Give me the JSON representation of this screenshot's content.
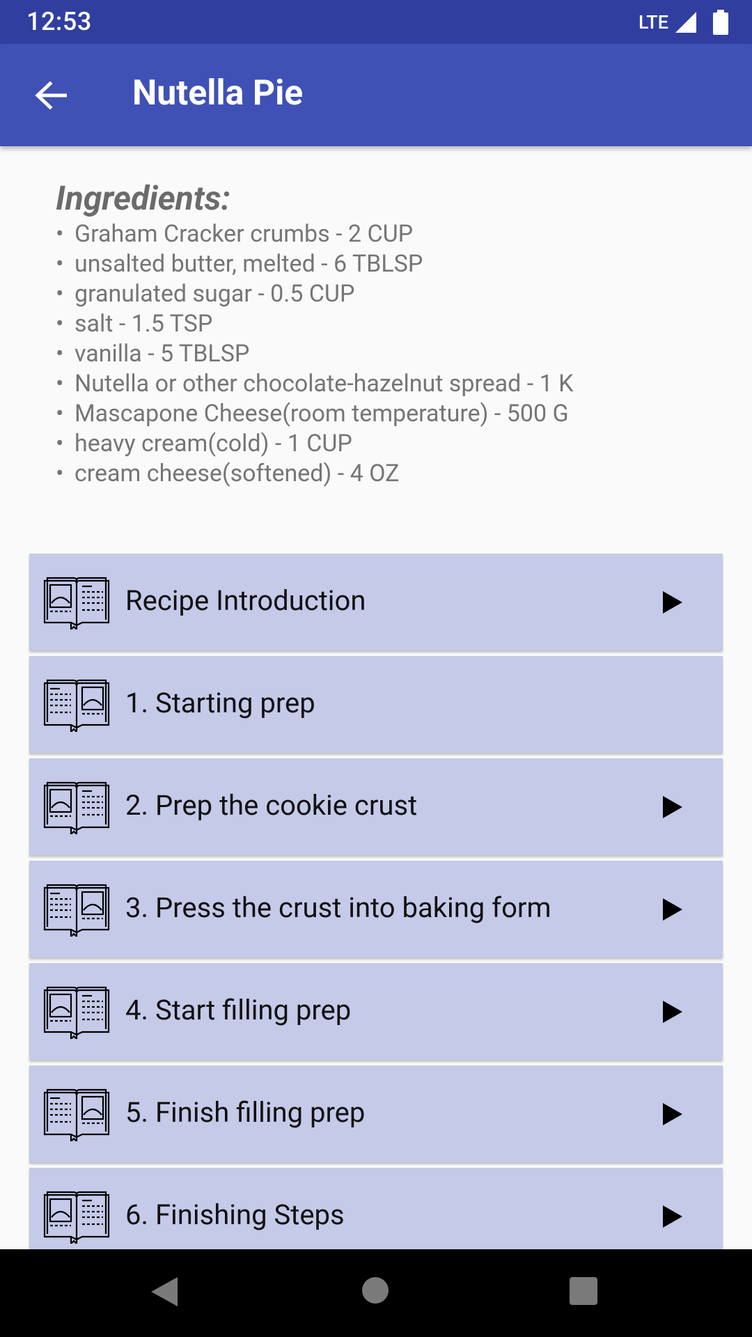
{
  "status": {
    "time": "12:53",
    "network": "LTE"
  },
  "app_bar": {
    "title": "Nutella Pie"
  },
  "ingredients": {
    "title": "Ingredients:",
    "bullet": "•",
    "items": [
      "Graham Cracker crumbs - 2 CUP",
      "unsalted butter, melted - 6 TBLSP",
      "granulated sugar - 0.5 CUP",
      "salt - 1.5 TSP",
      "vanilla - 5 TBLSP",
      "Nutella or other chocolate-hazelnut spread - 1 K",
      "Mascapone Cheese(room temperature) - 500 G",
      "heavy cream(cold) - 1 CUP",
      "cream cheese(softened) - 4 OZ"
    ]
  },
  "steps": [
    {
      "label": "Recipe Introduction",
      "icon": "recipe-book-icon",
      "has_video": true
    },
    {
      "label": "1. Starting prep",
      "icon": "recipe-book-icon",
      "has_video": false
    },
    {
      "label": "2. Prep the cookie crust",
      "icon": "recipe-book-icon",
      "has_video": true
    },
    {
      "label": "3. Press the crust into baking form",
      "icon": "recipe-book-icon",
      "has_video": true
    },
    {
      "label": "4. Start filling prep",
      "icon": "recipe-book-icon",
      "has_video": true
    },
    {
      "label": "5. Finish filling prep",
      "icon": "recipe-book-icon",
      "has_video": true
    },
    {
      "label": "6. Finishing Steps",
      "icon": "recipe-book-icon",
      "has_video": true
    }
  ],
  "colors": {
    "status_bar": "#303f9f",
    "app_bar": "#3f51b5",
    "step_card": "#c5cae9",
    "background": "#fafafa"
  }
}
